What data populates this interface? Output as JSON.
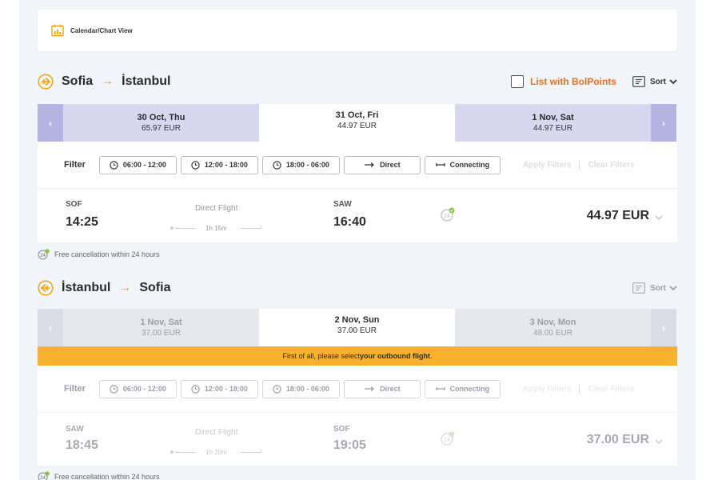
{
  "calendar_view": {
    "label": "Calendar/Chart View",
    "icon": "calendar-chart-icon"
  },
  "outbound": {
    "from": "Sofia",
    "arrow": "→",
    "to": "İstanbul",
    "list_bolpoints": "List with BolPoints",
    "sort_label": "Sort",
    "nav_prev": "‹",
    "nav_next": "›",
    "dates": [
      {
        "date": "30 Oct, Thu",
        "price": "65.97 EUR"
      },
      {
        "date": "31 Oct, Fri",
        "price": "44.97 EUR",
        "selected": true
      },
      {
        "date": "1 Nov, Sat",
        "price": "44.97 EUR"
      }
    ],
    "filter": {
      "label": "Filter",
      "times": [
        "06:00 - 12:00",
        "12:00 - 18:00",
        "18:00 - 06:00"
      ],
      "direct": "Direct",
      "connecting": "Connecting",
      "apply": "Apply Filters",
      "clear": "Clear Filters"
    },
    "flight": {
      "dep_code": "SOF",
      "dep_time": "14:25",
      "type": "Direct Flight",
      "duration": "1h 15m",
      "arr_code": "SAW",
      "arr_time": "16:40",
      "price": "44.97 EUR"
    },
    "cancellation": "Free cancellation within 24 hours"
  },
  "return": {
    "from": "İstanbul",
    "arrow": "→",
    "to": "Sofia",
    "sort_label": "Sort",
    "nav_prev": "‹",
    "nav_next": "›",
    "dates": [
      {
        "date": "1 Nov, Sat",
        "price": "37.00 EUR"
      },
      {
        "date": "2 Nov, Sun",
        "price": "37.00 EUR",
        "selected": true
      },
      {
        "date": "3 Nov, Mon",
        "price": "48.00 EUR"
      }
    ],
    "banner_prefix": "First of all, please select ",
    "banner_bold": "your outbound flight",
    "banner_suffix": ".",
    "filter": {
      "label": "Filter",
      "times": [
        "06:00 - 12:00",
        "12:00 - 18:00",
        "18:00 - 06:00"
      ],
      "direct": "Direct",
      "connecting": "Connecting",
      "apply": "Apply Filters",
      "clear": "Clear Filters"
    },
    "flight": {
      "dep_code": "SAW",
      "dep_time": "18:45",
      "type": "Direct Flight",
      "duration": "1h 20m",
      "arr_code": "SOF",
      "arr_time": "19:05",
      "price": "37.00 EUR"
    },
    "cancellation": "Free cancellation within 24 hours"
  },
  "colors": {
    "accent": "#f7a400",
    "bolpoints": "#ec6f1e",
    "date_bar": "#d8d7f0",
    "nav": "#b4b4e2",
    "banner": "#f7b12c"
  }
}
